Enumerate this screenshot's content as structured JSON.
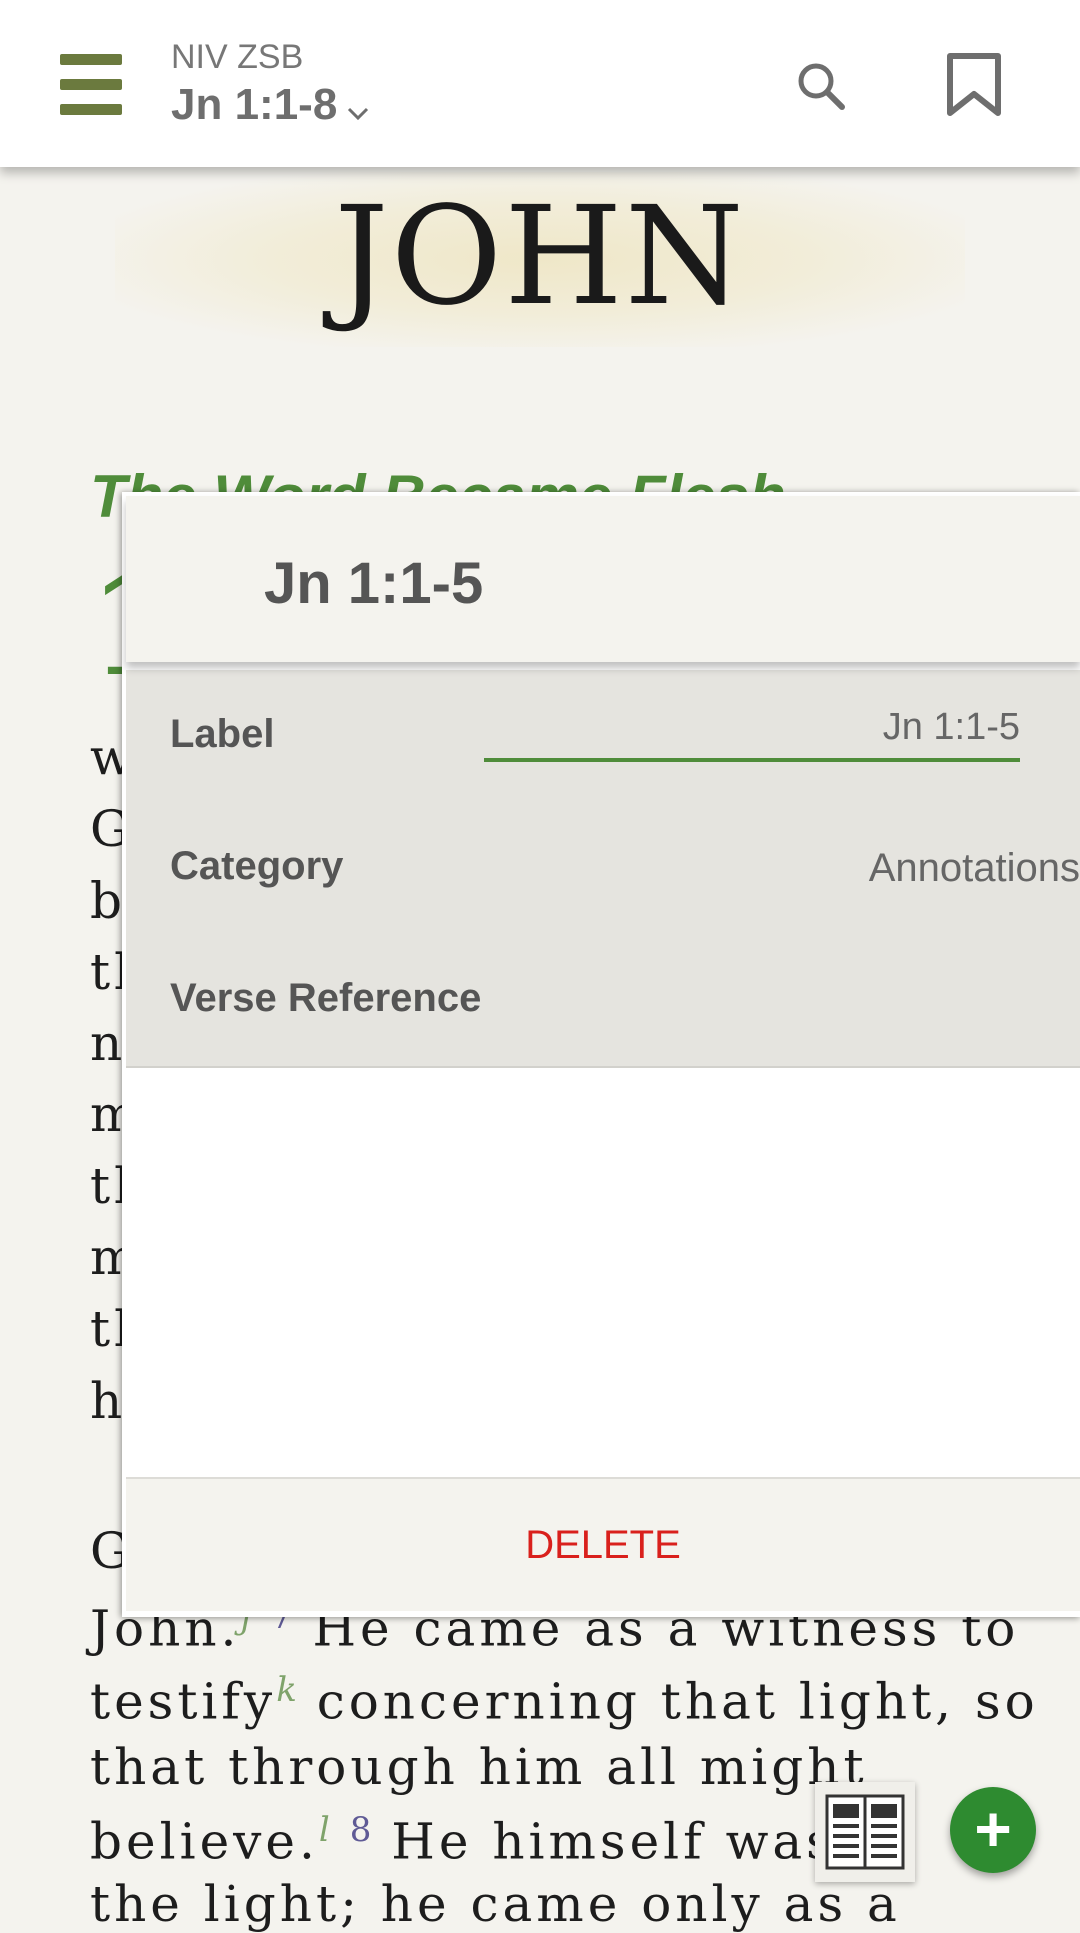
{
  "header": {
    "version": "NIV ZSB",
    "reference": "Jn 1:1-8"
  },
  "book": {
    "title": "JOHN",
    "section_heading": "The Word Became Flesh",
    "chapter_number": "1"
  },
  "text_lines": [
    {
      "text": "w"
    },
    {
      "text": "G"
    },
    {
      "text": "b"
    },
    {
      "text": "tl"
    },
    {
      "text": "n"
    },
    {
      "text": "m"
    },
    {
      "text": "tl"
    },
    {
      "text": "m"
    },
    {
      "text": "tl"
    },
    {
      "text": "h"
    },
    {
      "text": "G"
    }
  ],
  "text_lower": {
    "line1_a": "John.",
    "line1_fn": "j",
    "line1_vn": "7",
    "line1_b": "He came as a witness to",
    "line2_a": "testify",
    "line2_fn": "k",
    "line2_b": "concerning that light, so",
    "line3": "that through him all might",
    "line4_a": "believe.",
    "line4_fn": "l",
    "line4_vn": "8",
    "line4_b": "He himself was n",
    "line5": "the light; he came only as a"
  },
  "dialog": {
    "title": "Jn 1:1-5",
    "label_field_label": "Label",
    "label_value": "Jn 1:1-5",
    "category_label": "Category",
    "category_value": "Annotations",
    "verse_reference_label": "Verse Reference",
    "delete_label": "DELETE"
  },
  "colors": {
    "accent_green": "#4f8c3a",
    "menu_olive": "#6b7a3e",
    "delete_red": "#d9201c",
    "fab_green": "#2e8b30"
  },
  "icons": [
    "hamburger-menu-icon",
    "chevron-down-icon",
    "search-icon",
    "bookmark-icon",
    "notes-icon",
    "plus-icon"
  ]
}
